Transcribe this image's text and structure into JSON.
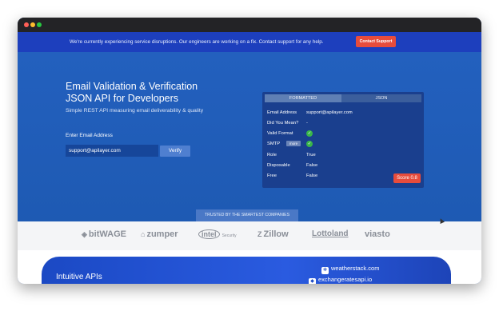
{
  "banner": {
    "message": "We're currently experiencing service disruptions. Our engineers are working on a fix. Contact support for any help.",
    "button": "Contact Support"
  },
  "hero": {
    "title_line1": "Email Validation & Verification",
    "title_line2": "JSON API for Developers",
    "subtitle": "Simple REST API measuring email deliverability & quality",
    "email_label": "Enter Email Address",
    "email_value": "support@apilayer.com",
    "verify_button": "Verify"
  },
  "panel": {
    "tabs": [
      "FORMATTED",
      "JSON"
    ],
    "active_tab": "FORMATTED",
    "rows": [
      {
        "key": "Email Address",
        "value": "support@apilayer.com"
      },
      {
        "key": "Did You Mean?",
        "value": "-"
      },
      {
        "key": "Valid Format",
        "value": "✓",
        "type": "check"
      },
      {
        "key": "SMTP",
        "value": "✓",
        "type": "check",
        "extra": "more"
      },
      {
        "key": "Role",
        "value": "True"
      },
      {
        "key": "Disposable",
        "value": "False"
      },
      {
        "key": "Free",
        "value": "False"
      }
    ],
    "score": "Score 0.8"
  },
  "trusted": "TRUSTED BY THE SMARTEST COMPANIES",
  "logos": [
    {
      "name": "bitwage-logo",
      "text": "bitWAGE",
      "icon": "◈"
    },
    {
      "name": "zumper-logo",
      "text": "zumper",
      "icon": "⌂"
    },
    {
      "name": "intel-logo",
      "text": "intel",
      "sub": "Security"
    },
    {
      "name": "zillow-logo",
      "text": "Zillow",
      "icon": "Z"
    },
    {
      "name": "lottoland-logo",
      "text": "Lottoland"
    },
    {
      "name": "viasto-logo",
      "text": "viasto"
    }
  ],
  "bottom": {
    "title": "Intuitive APIs",
    "links": [
      "weatherstack.com",
      "exchangeratesapi.io"
    ]
  },
  "colors": {
    "accent_red": "#e74c3c",
    "hero_blue": "#2360be",
    "banner_blue": "#1d3fbd",
    "check_green": "#39b54a"
  }
}
